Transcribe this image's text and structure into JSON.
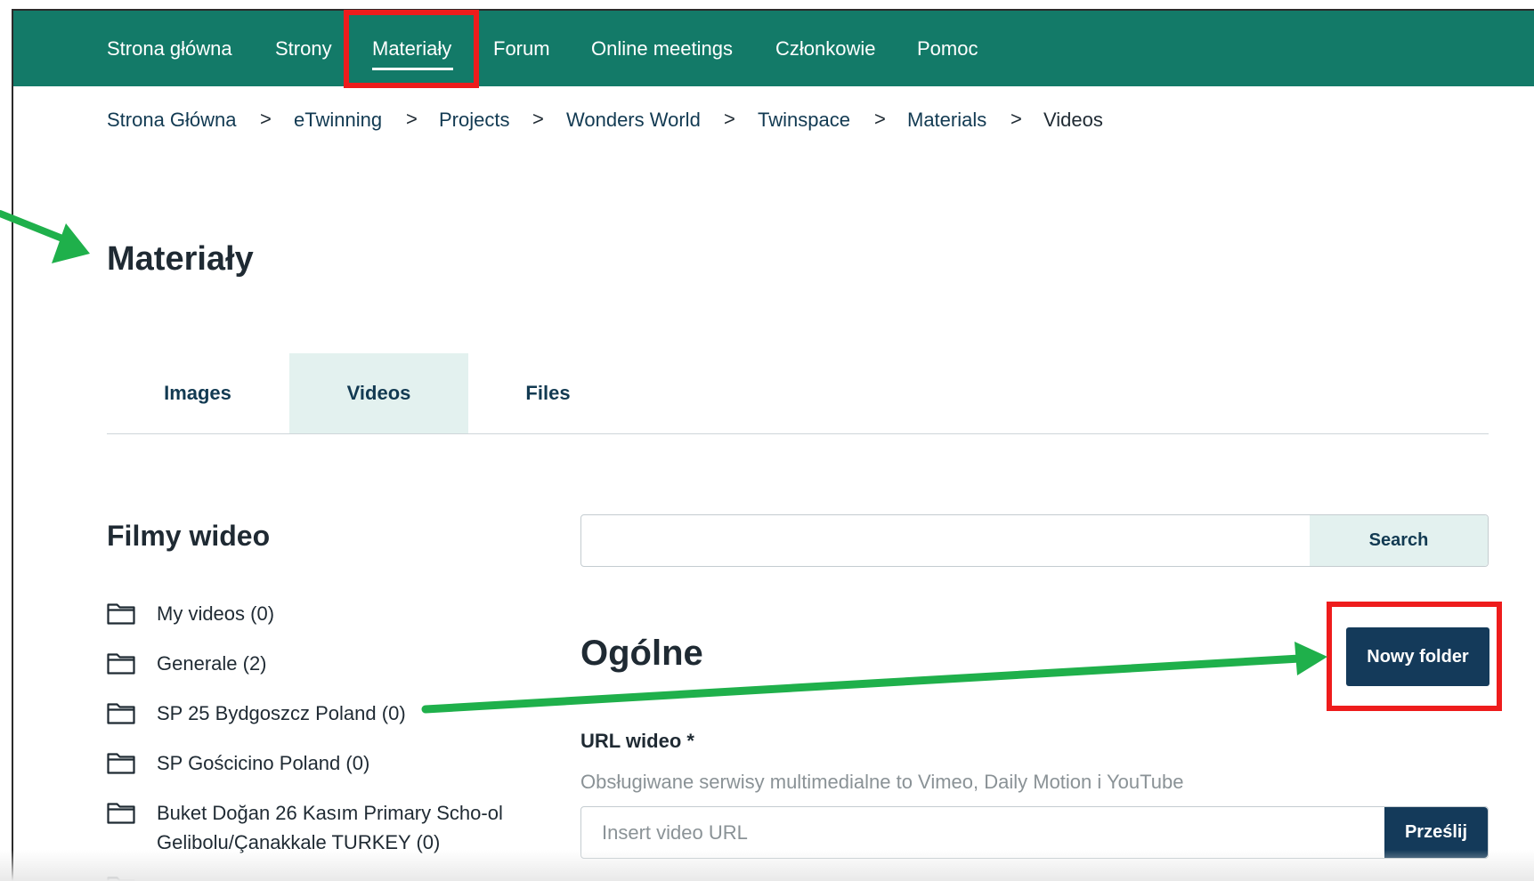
{
  "nav": {
    "items": [
      {
        "label": "Strona główna"
      },
      {
        "label": "Strony"
      },
      {
        "label": "Materiały"
      },
      {
        "label": "Forum"
      },
      {
        "label": "Online meetings"
      },
      {
        "label": "Członkowie"
      },
      {
        "label": "Pomoc"
      }
    ],
    "active_index": 2
  },
  "breadcrumb": {
    "items": [
      {
        "label": "Strona Główna"
      },
      {
        "label": "eTwinning"
      },
      {
        "label": "Projects"
      },
      {
        "label": "Wonders World"
      },
      {
        "label": "Twinspace"
      },
      {
        "label": "Materials"
      },
      {
        "label": "Videos"
      }
    ],
    "separator": ">"
  },
  "page": {
    "title": "Materiały"
  },
  "tabs": {
    "items": [
      {
        "label": "Images"
      },
      {
        "label": "Videos"
      },
      {
        "label": "Files"
      }
    ],
    "active_index": 1
  },
  "sidebar": {
    "title": "Filmy wideo",
    "folders": [
      {
        "label": "My videos (0)"
      },
      {
        "label": "Generale (2)"
      },
      {
        "label": "SP 25 Bydgoszcz Poland (0)"
      },
      {
        "label": "SP Gościcino Poland (0)"
      },
      {
        "label": "Buket Doğan 26 Kasım Primary Scho-ol Gelibolu/Çanakkale TURKEY (0)"
      }
    ]
  },
  "search": {
    "value": "",
    "button_label": "Search"
  },
  "section": {
    "title": "Ogólne",
    "new_folder_label": "Nowy folder",
    "url_label": "URL wideo *",
    "url_help": "Obsługiwane serwisy multimedialne to Vimeo, Daily Motion i YouTube",
    "url_placeholder": "Insert video URL",
    "submit_label": "Prześlij"
  },
  "colors": {
    "nav_bg": "#137a68",
    "primary_button": "#143a5a",
    "active_tab_bg": "#e3f1ef",
    "highlight_box": "#ee1c1c",
    "annotation_arrow": "#1fb04b"
  },
  "icons": {
    "folder": "folder-icon",
    "breadcrumb_separator": "chevron-right-icon"
  }
}
